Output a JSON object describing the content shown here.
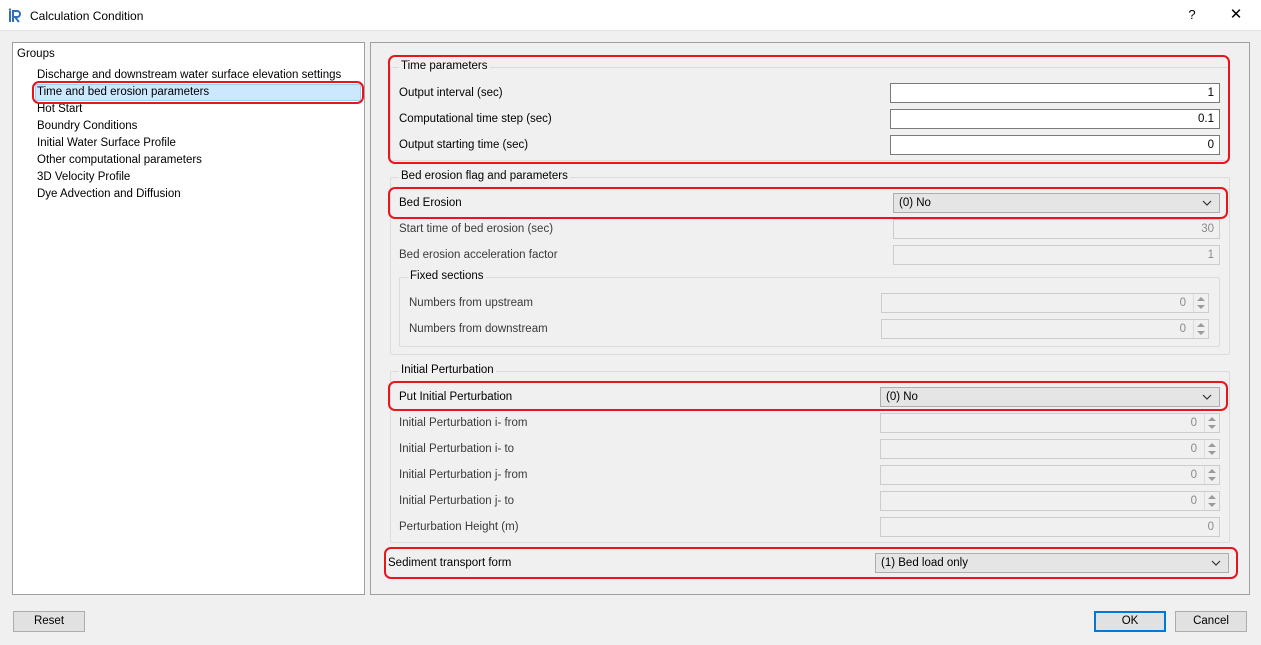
{
  "window": {
    "title": "Calculation Condition",
    "help_glyph": "?",
    "close_glyph": "✕"
  },
  "groups": {
    "header": "Groups",
    "items": [
      {
        "label": "Discharge and downstream water surface elevation settings"
      },
      {
        "label": "Time and bed erosion parameters",
        "selected": true
      },
      {
        "label": "Hot Start"
      },
      {
        "label": "Boundry Conditions"
      },
      {
        "label": "Initial Water Surface Profile"
      },
      {
        "label": "Other computational parameters"
      },
      {
        "label": "3D Velocity Profile"
      },
      {
        "label": "Dye Advection and Diffusion"
      }
    ]
  },
  "time_parameters": {
    "title": "Time parameters",
    "output_interval": {
      "label": "Output interval (sec)",
      "value": "1"
    },
    "computational_time_step": {
      "label": "Computational time step (sec)",
      "value": "0.1"
    },
    "output_starting_time": {
      "label": "Output starting time (sec)",
      "value": "0"
    }
  },
  "bed_erosion": {
    "title": "Bed erosion flag and parameters",
    "bed_erosion": {
      "label": "Bed Erosion",
      "value": "(0) No"
    },
    "start_time": {
      "label": "Start time of bed erosion (sec)",
      "value": "30"
    },
    "acceleration_factor": {
      "label": "Bed erosion acceleration factor",
      "value": "1"
    },
    "fixed_sections": {
      "title": "Fixed sections",
      "from_upstream": {
        "label": "Numbers from upstream",
        "value": "0"
      },
      "from_downstream": {
        "label": "Numbers from downstream",
        "value": "0"
      }
    }
  },
  "initial_perturbation": {
    "title": "Initial Perturbation",
    "put": {
      "label": "Put Initial Perturbation",
      "value": "(0) No"
    },
    "i_from": {
      "label": "Initial Perturbation i- from",
      "value": "0"
    },
    "i_to": {
      "label": "Initial Perturbation i- to",
      "value": "0"
    },
    "j_from": {
      "label": "Initial Perturbation j- from",
      "value": "0"
    },
    "j_to": {
      "label": "Initial Perturbation j- to",
      "value": "0"
    },
    "height": {
      "label": "Perturbation Height (m)",
      "value": "0"
    }
  },
  "sediment": {
    "label": "Sediment transport form",
    "value": "(1) Bed load only"
  },
  "footer": {
    "reset": "Reset",
    "ok": "OK",
    "cancel": "Cancel"
  },
  "colors": {
    "highlight": "#e8151b",
    "selection": "#cce8ff",
    "app_icon": "#2f6fb7"
  }
}
